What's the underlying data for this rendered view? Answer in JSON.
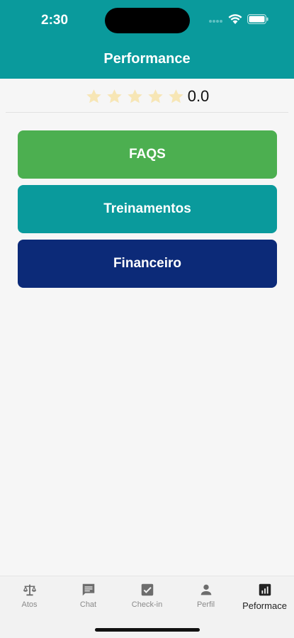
{
  "status_bar": {
    "time": "2:30"
  },
  "header": {
    "title": "Performance"
  },
  "rating": {
    "stars_filled": 0,
    "stars_total": 5,
    "value": "0.0",
    "star_color": "#f7e6b5"
  },
  "buttons": {
    "faqs": "FAQS",
    "treinamentos": "Treinamentos",
    "financeiro": "Financeiro"
  },
  "colors": {
    "primary": "#0a9a9c",
    "faqs": "#4caf50",
    "financeiro": "#0c2a78"
  },
  "bottom_nav": {
    "items": [
      {
        "label": "Atos",
        "icon": "scale-icon"
      },
      {
        "label": "Chat",
        "icon": "chat-icon"
      },
      {
        "label": "Check-in",
        "icon": "checkbox-icon"
      },
      {
        "label": "Perfil",
        "icon": "person-icon"
      },
      {
        "label": "Peformace",
        "icon": "bar-chart-icon",
        "active": true
      }
    ]
  }
}
